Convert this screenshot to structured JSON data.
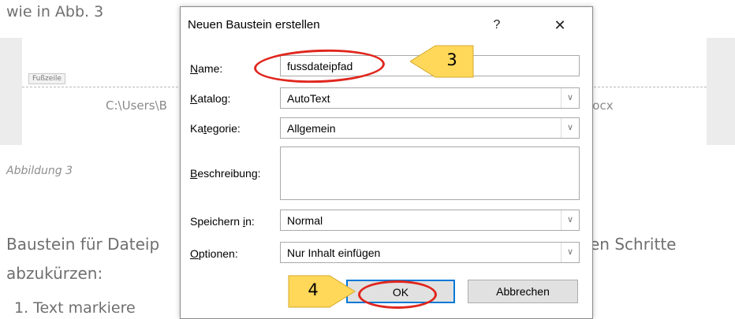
{
  "document": {
    "top_text": "wie in Abb. 3",
    "footer_tag": "Fußzeile",
    "footer_path_left": "C:\\Users\\B",
    "footer_path_right": ".docx",
    "caption": "Abbildung 3",
    "paragraph_left": "Baustein für Dateip",
    "paragraph_right": "en Schritte",
    "paragraph_line2": "abzukürzen:",
    "list_item_1": "1.   Text markiere"
  },
  "dialog": {
    "title": "Neuen Baustein erstellen",
    "help_label": "?",
    "close_label": "✕",
    "fields": {
      "name": {
        "label_accel": "N",
        "label_rest": "ame:",
        "value": "fussdateipfad"
      },
      "katalog": {
        "label_accel": "K",
        "label_rest": "atalog:",
        "value": "AutoText"
      },
      "kategorie": {
        "label_pre": "Ka",
        "label_accel": "t",
        "label_rest": "egorie:",
        "value": "Allgemein"
      },
      "beschreibung": {
        "label_accel": "B",
        "label_rest": "eschreibung:",
        "value": ""
      },
      "speichern": {
        "label_pre": "Speichern ",
        "label_accel": "i",
        "label_rest": "n:",
        "value": "Normal"
      },
      "optionen": {
        "label_accel": "O",
        "label_rest": "ptionen:",
        "value": "Nur Inhalt einfügen"
      }
    },
    "ok_label": "OK",
    "cancel_label": "Abbrechen"
  },
  "annotations": {
    "callout_3": "3",
    "callout_4": "4",
    "highlight_color": "#e0261d",
    "callout_color": "#ffd85a"
  }
}
